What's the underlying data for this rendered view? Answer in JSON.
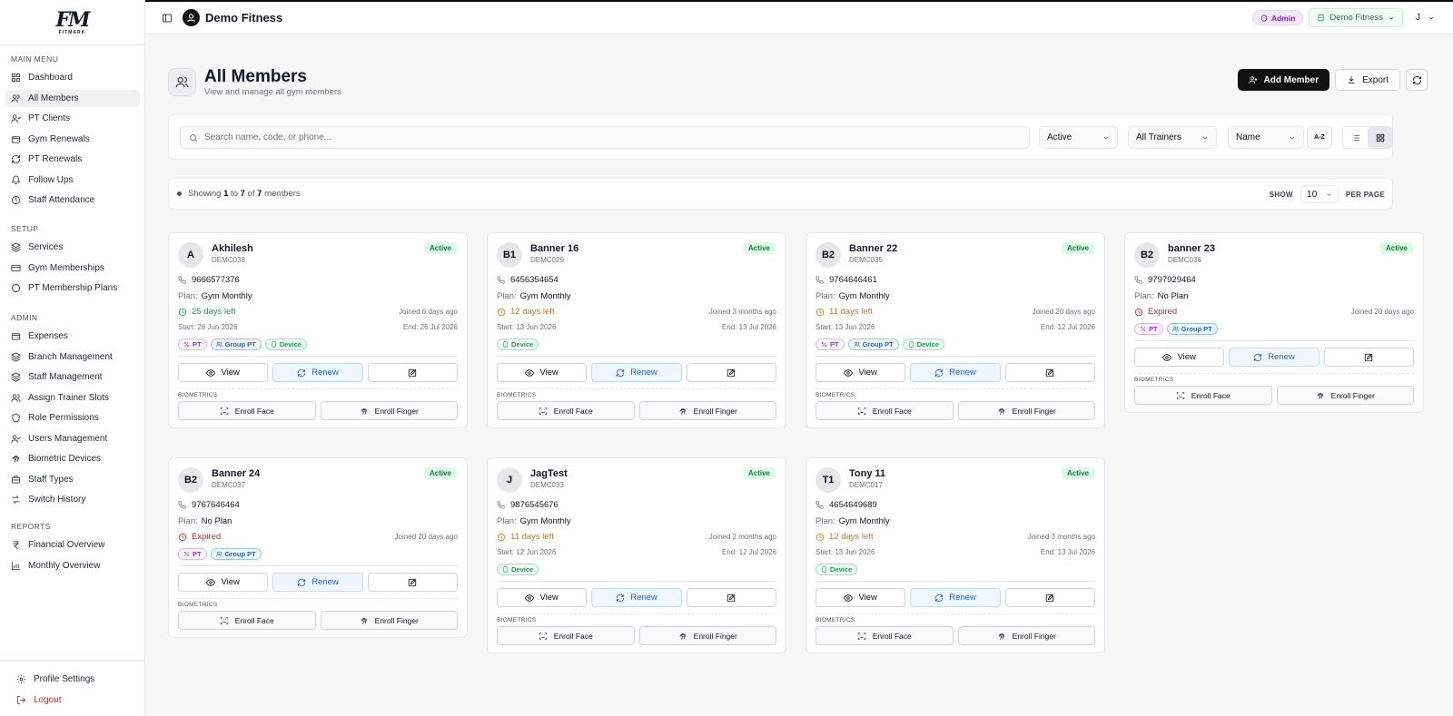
{
  "app": {
    "brand": "Demo Fitness",
    "logo_main": "FM",
    "logo_sub": "FITMARK"
  },
  "topbar": {
    "admin_badge": "Admin",
    "gym_selector": "Demo Fitness",
    "user_initial": "J"
  },
  "sidebar": {
    "sections": [
      {
        "title": "MAIN MENU",
        "items": [
          {
            "label": "Dashboard",
            "icon": "dashboard-icon"
          },
          {
            "label": "All Members",
            "icon": "members-icon",
            "active": true
          },
          {
            "label": "PT Clients",
            "icon": "pt-clients-icon"
          },
          {
            "label": "Gym Renewals",
            "icon": "wallet-icon"
          },
          {
            "label": "PT Renewals",
            "icon": "refresh-icon"
          },
          {
            "label": "Follow Ups",
            "icon": "bell-icon"
          },
          {
            "label": "Staff Attendance",
            "icon": "clock-icon"
          }
        ]
      },
      {
        "title": "SETUP",
        "items": [
          {
            "label": "Services",
            "icon": "layers-icon"
          },
          {
            "label": "Gym Memberships",
            "icon": "card-icon"
          },
          {
            "label": "PT Membership Plans",
            "icon": "circle-icon"
          }
        ]
      },
      {
        "title": "ADMIN",
        "items": [
          {
            "label": "Expenses",
            "icon": "wallet-icon"
          },
          {
            "label": "Branch Management",
            "icon": "layers-icon"
          },
          {
            "label": "Staff Management",
            "icon": "layers-icon"
          },
          {
            "label": "Assign Trainer Slots",
            "icon": "users-icon"
          },
          {
            "label": "Role Permissions",
            "icon": "shield-icon"
          },
          {
            "label": "Users Management",
            "icon": "user-check-icon"
          },
          {
            "label": "Biometric Devices",
            "icon": "fingerprint-icon"
          },
          {
            "label": "Staff Types",
            "icon": "briefcase-icon"
          },
          {
            "label": "Switch History",
            "icon": "switch-icon"
          }
        ]
      },
      {
        "title": "REPORTS",
        "items": [
          {
            "label": "Financial Overview",
            "icon": "rupee-icon"
          },
          {
            "label": "Monthly Overview",
            "icon": "bar-chart-icon"
          }
        ]
      }
    ],
    "footer": {
      "profile": "Profile Settings",
      "logout": "Logout"
    }
  },
  "page": {
    "title": "All Members",
    "subtitle": "View and manage all gym members",
    "add_button": "Add Member",
    "export_button": "Export"
  },
  "filters": {
    "search_placeholder": "Search name, code, or phone...",
    "status": "Active",
    "trainer": "All Trainers",
    "sort": "Name",
    "sort_dir": "A-Z"
  },
  "summary": {
    "showing": "Showing",
    "from": "1",
    "to_word": "to",
    "to": "7",
    "of_word": "of",
    "total": "7",
    "suffix": "members",
    "show_label": "SHOW",
    "per_page": "10",
    "per_page_label": "PER PAGE"
  },
  "card_labels": {
    "plan": "Plan:",
    "start": "Start:",
    "end": "End:",
    "view": "View",
    "renew": "Renew",
    "biometrics": "BIOMETRICS",
    "enroll_face": "Enroll Face",
    "enroll_finger": "Enroll Finger"
  },
  "members": [
    {
      "initials": "A",
      "name": "Akhilesh",
      "code": "DEMC038",
      "status": "Active",
      "phone": "9666577376",
      "plan": "Gym Monthly",
      "days_left": "25 days left",
      "days_state": "green",
      "joined": "Joined 6 days ago",
      "start": "26 Jun 2026",
      "end": "26 Jul 2026",
      "tags": [
        "PT",
        "Group PT",
        "Device"
      ]
    },
    {
      "initials": "B1",
      "name": "Banner 16",
      "code": "DEMC029",
      "status": "Active",
      "phone": "6456354654",
      "plan": "Gym Monthly",
      "days_left": "12 days left",
      "days_state": "amber",
      "joined": "Joined 3 months ago",
      "start": "13 Jun 2026",
      "end": "13 Jul 2026",
      "tags": [
        "Device"
      ]
    },
    {
      "initials": "B2",
      "name": "Banner 22",
      "code": "DEMC035",
      "status": "Active",
      "phone": "9764646461",
      "plan": "Gym Monthly",
      "days_left": "11 days left",
      "days_state": "amber",
      "joined": "Joined 20 days ago",
      "start": "13 Jun 2026",
      "end": "12 Jul 2026",
      "tags": [
        "PT",
        "Group PT",
        "Device"
      ]
    },
    {
      "initials": "B2",
      "name": "banner 23",
      "code": "DEMC036",
      "status": "Active",
      "phone": "9797929464",
      "plan": "No Plan",
      "days_left": "Expired",
      "days_state": "red",
      "joined": "Joined 20 days ago",
      "tags": [
        "PT",
        "Group PT"
      ]
    },
    {
      "initials": "B2",
      "name": "Banner 24",
      "code": "DEMC037",
      "status": "Active",
      "phone": "9767646464",
      "plan": "No Plan",
      "days_left": "Expired",
      "days_state": "red",
      "joined": "Joined 20 days ago",
      "tags": [
        "PT",
        "Group PT"
      ]
    },
    {
      "initials": "J",
      "name": "JagTest",
      "code": "DEMC033",
      "status": "Active",
      "phone": "9876545676",
      "plan": "Gym Monthly",
      "days_left": "11 days left",
      "days_state": "amber",
      "joined": "Joined 2 months ago",
      "start": "12 Jun 2026",
      "end": "12 Jul 2026",
      "tags": [
        "Device"
      ]
    },
    {
      "initials": "T1",
      "name": "Tony 11",
      "code": "DEMC017",
      "status": "Active",
      "phone": "4654649689",
      "plan": "Gym Monthly",
      "days_left": "12 days left",
      "days_state": "amber",
      "joined": "Joined 3 months ago",
      "start": "13 Jun 2026",
      "end": "13 Jul 2026",
      "tags": [
        "Device"
      ]
    }
  ]
}
